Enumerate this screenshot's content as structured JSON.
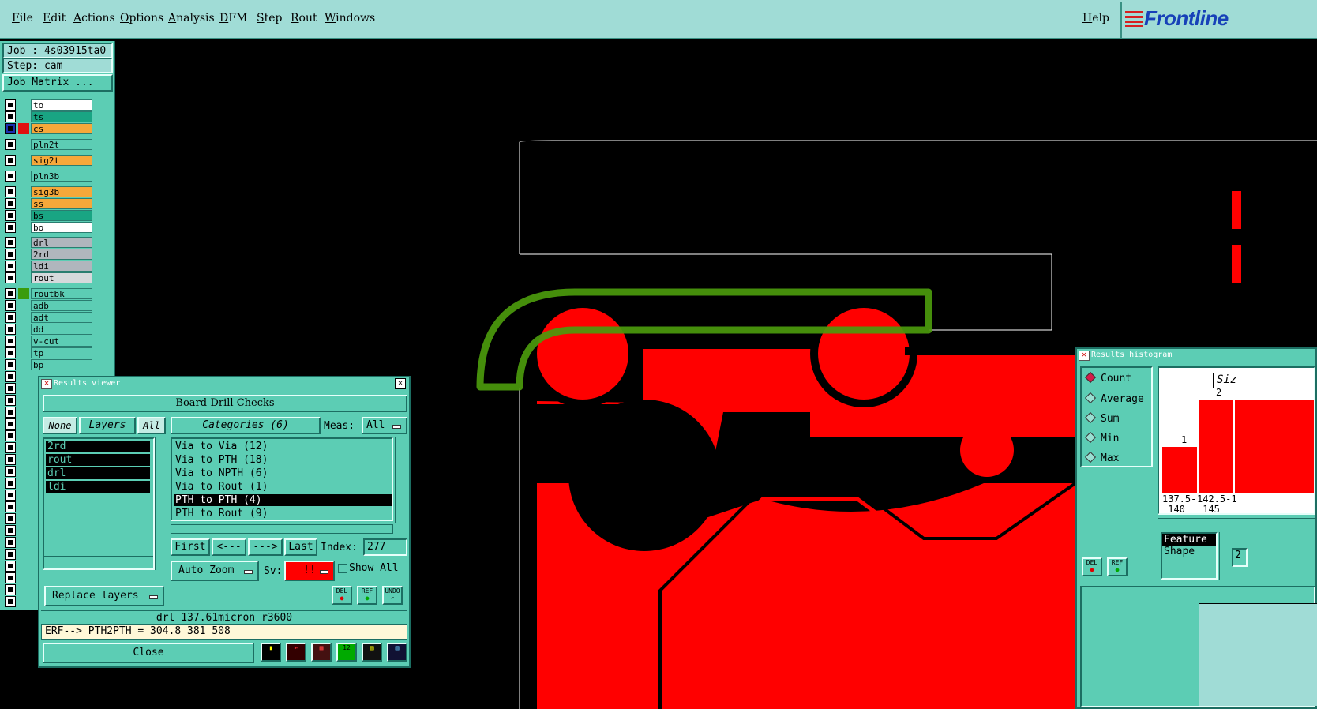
{
  "menu": {
    "items": [
      "File",
      "Edit",
      "Actions",
      "Options",
      "Analysis",
      "DFM",
      "Step",
      "Rout",
      "Windows"
    ],
    "help": "Help",
    "logo": "Frontline"
  },
  "job": {
    "job_label": "Job : 4s03915ta0",
    "step_label": "Step: cam",
    "matrix_button": "Job Matrix ..."
  },
  "layers": [
    {
      "name": "to",
      "color": "#ffffff"
    },
    {
      "name": "ts",
      "color": "#19a583"
    },
    {
      "name": "cs",
      "color": "#f6a83a"
    },
    {
      "name": "pln2t",
      "color": "#5ccdb4"
    },
    {
      "name": "sig2t",
      "color": "#f6a83a"
    },
    {
      "name": "pln3b",
      "color": "#5ccdb4"
    },
    {
      "name": "sig3b",
      "color": "#f6a83a"
    },
    {
      "name": "ss",
      "color": "#f6a83a"
    },
    {
      "name": "bs",
      "color": "#19a583"
    },
    {
      "name": "bo",
      "color": "#ffffff"
    },
    {
      "name": "drl",
      "color": "#b0b6bd"
    },
    {
      "name": "2rd",
      "color": "#b0b6bd"
    },
    {
      "name": "ldi",
      "color": "#b0b6bd"
    },
    {
      "name": "rout",
      "color": "#d6d9dc"
    },
    {
      "name": "routbk",
      "color": "#5ccdb4"
    },
    {
      "name": "adb",
      "color": "#5ccdb4"
    },
    {
      "name": "adt",
      "color": "#5ccdb4"
    },
    {
      "name": "dd",
      "color": "#5ccdb4"
    },
    {
      "name": "v-cut",
      "color": "#5ccdb4"
    },
    {
      "name": "tp",
      "color": "#5ccdb4"
    },
    {
      "name": "bp",
      "color": "#5ccdb4"
    }
  ],
  "results_viewer": {
    "title": "Results viewer",
    "heading": "Board-Drill Checks",
    "none_btn": "None",
    "layers_btn": "Layers",
    "all_btn": "All",
    "categories_btn": "Categories (6)",
    "meas_label": "Meas:",
    "meas_value": "All",
    "layer_list": [
      "2rd",
      "rout",
      "drl",
      "ldi"
    ],
    "categories": [
      "Via to Via  (12)",
      "Via to PTH  (18)",
      "Via to NPTH  (6)",
      "Via to Rout  (1)",
      "PTH to PTH  (4)",
      "PTH to Rout  (9)"
    ],
    "first_btn": "First",
    "prev_btn": "<---",
    "next_btn": "--->",
    "last_btn": "Last",
    "index_label": "Index:",
    "index_value": "277",
    "autozoom_btn": "Auto Zoom",
    "sv_label": "Sv:",
    "sv_value": "!!",
    "show_all": "Show All",
    "replace_btn": "Replace layers",
    "del_label": "DEL",
    "ref_label": "REF",
    "undo_label": "UNDO",
    "status_line": "drl 137.61micron  r3600",
    "erf_line": "ERF--> PTH2PTH = 304.8 381 508",
    "close_btn": "Close"
  },
  "histogram": {
    "title": "Results histogram",
    "options": [
      "Count",
      "Average",
      "Sum",
      "Min",
      "Max"
    ],
    "size_label": "Siz",
    "feature_label": "Feature",
    "shape_label": "Shape",
    "del_label": "DEL",
    "ref_label": "REF",
    "bar_labels": [
      "1",
      "2"
    ],
    "bin_labels": [
      "137.5-",
      "142.5-1"
    ],
    "bin_labels2": [
      "140",
      "145"
    ],
    "stepper_value": "2"
  },
  "colors": {
    "copper": "#ff0000",
    "rout": "#4b9a0c",
    "panel": "#5ccdb4",
    "menubar": "#a0dcd6"
  }
}
